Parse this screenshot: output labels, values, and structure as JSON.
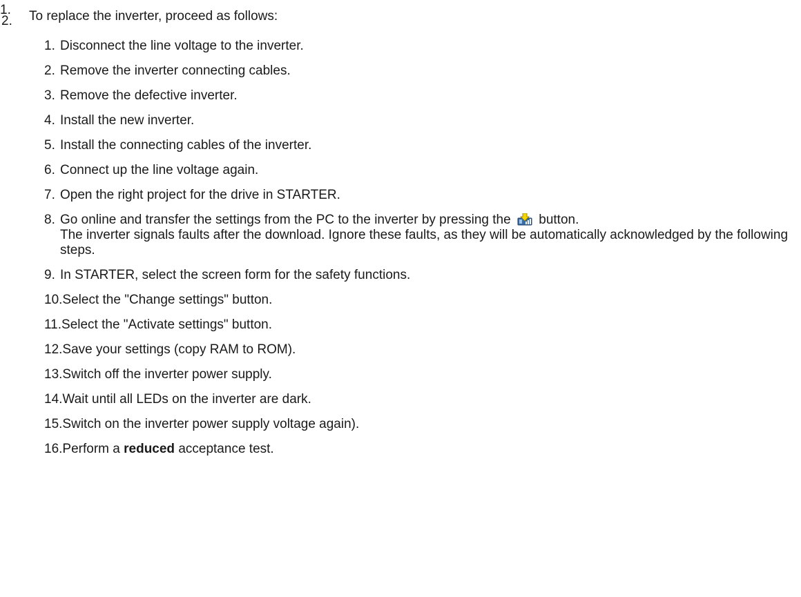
{
  "outer_numbers": [
    "1.",
    "2."
  ],
  "intro": "To replace the inverter, proceed as follows:",
  "steps": [
    {
      "num": "1.",
      "text": "Disconnect the line voltage to the inverter."
    },
    {
      "num": "2.",
      "text": "Remove the inverter connecting cables."
    },
    {
      "num": "3.",
      "text": "Remove the defective inverter."
    },
    {
      "num": "4.",
      "text": "Install the new inverter."
    },
    {
      "num": "5.",
      "text": "Install the connecting cables of the inverter."
    },
    {
      "num": "6.",
      "text": "Connect up the line voltage again."
    },
    {
      "num": "7.",
      "text": "Open the right project for the drive in STARTER."
    },
    {
      "num": "8.",
      "text_before": "Go online and transfer the settings from the PC to the inverter by pressing the",
      "icon": "download-to-device-icon",
      "text_after": "button.",
      "line2": "The inverter signals faults after the download. Ignore these faults, as they will be automatically acknowledged by the following steps."
    },
    {
      "num": "9.",
      "text": "In STARTER, select the screen form for the safety functions."
    },
    {
      "num": "10.",
      "text": "Select the \"Change settings\" button."
    },
    {
      "num": "11.",
      "text": "Select the \"Activate settings\" button."
    },
    {
      "num": "12.",
      "text": "Save your settings (copy RAM to ROM)."
    },
    {
      "num": "13.",
      "text": "Switch off the inverter power supply."
    },
    {
      "num": "14.",
      "text": "Wait until all LEDs on the inverter are dark."
    },
    {
      "num": "15.",
      "text": "Switch on the inverter power supply voltage again)."
    },
    {
      "num": "16.",
      "text_before": "Perform a",
      "bold": "reduced",
      "text_after": "acceptance test."
    }
  ]
}
